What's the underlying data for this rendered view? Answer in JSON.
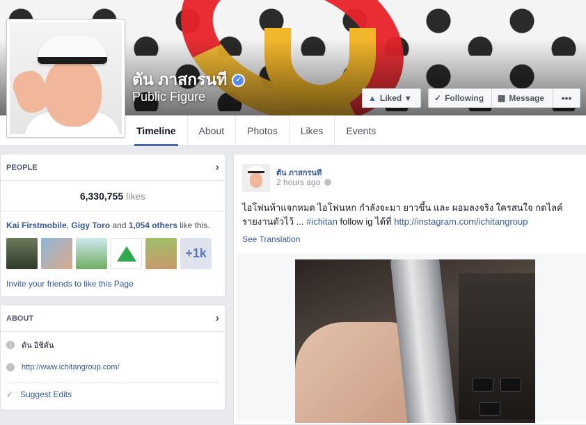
{
  "page": {
    "name": "ตัน ภาสกรนที",
    "category": "Public Figure",
    "verified_glyph": "✓"
  },
  "actions": {
    "liked_label": "Liked",
    "liked_caret": "▾",
    "following_label": "Following",
    "message_label": "Message",
    "more_label": "•••"
  },
  "tabs": [
    {
      "label": "Timeline",
      "active": true
    },
    {
      "label": "About"
    },
    {
      "label": "Photos"
    },
    {
      "label": "Likes"
    },
    {
      "label": "Events"
    }
  ],
  "people": {
    "heading": "PEOPLE",
    "likes_count": "6,330,755",
    "likes_label": "likes",
    "friend1": "Kai Firstmobile",
    "friend2": "Gigy Toro",
    "and_text": " and ",
    "others": "1,054 others",
    "like_this": " like this.",
    "more_count": "+1k",
    "invite": "Invite your friends to like this Page"
  },
  "about": {
    "heading": "ABOUT",
    "name_thai": "ตัน อิชิตัน",
    "website": "http://www.ichitangroup.com/",
    "suggest_edits": "Suggest Edits"
  },
  "post": {
    "author": "ตัน ภาสกรนที",
    "time": "2 hours ago",
    "text_line1": "ไอโฟนห้าแจกหมด ไอโฟนหก กำลังจะมา ยาวขึ้น และ ผอมลงจริง ใครสนใจ กดไลค์",
    "text_line2_a": "รายงานตัวไว้ ... ",
    "hashtag": "#ichitan",
    "text_line2_b": " follow ig ได้ที่ ",
    "link": "http://instagram.com/ichitangroup",
    "see_translation": "See Translation"
  },
  "colors": {
    "fb_blue": "#4267b2",
    "link": "#365899",
    "verified": "#5890ff"
  },
  "icons": {
    "chevron": "›",
    "check": "✓",
    "thumb": "👍"
  }
}
